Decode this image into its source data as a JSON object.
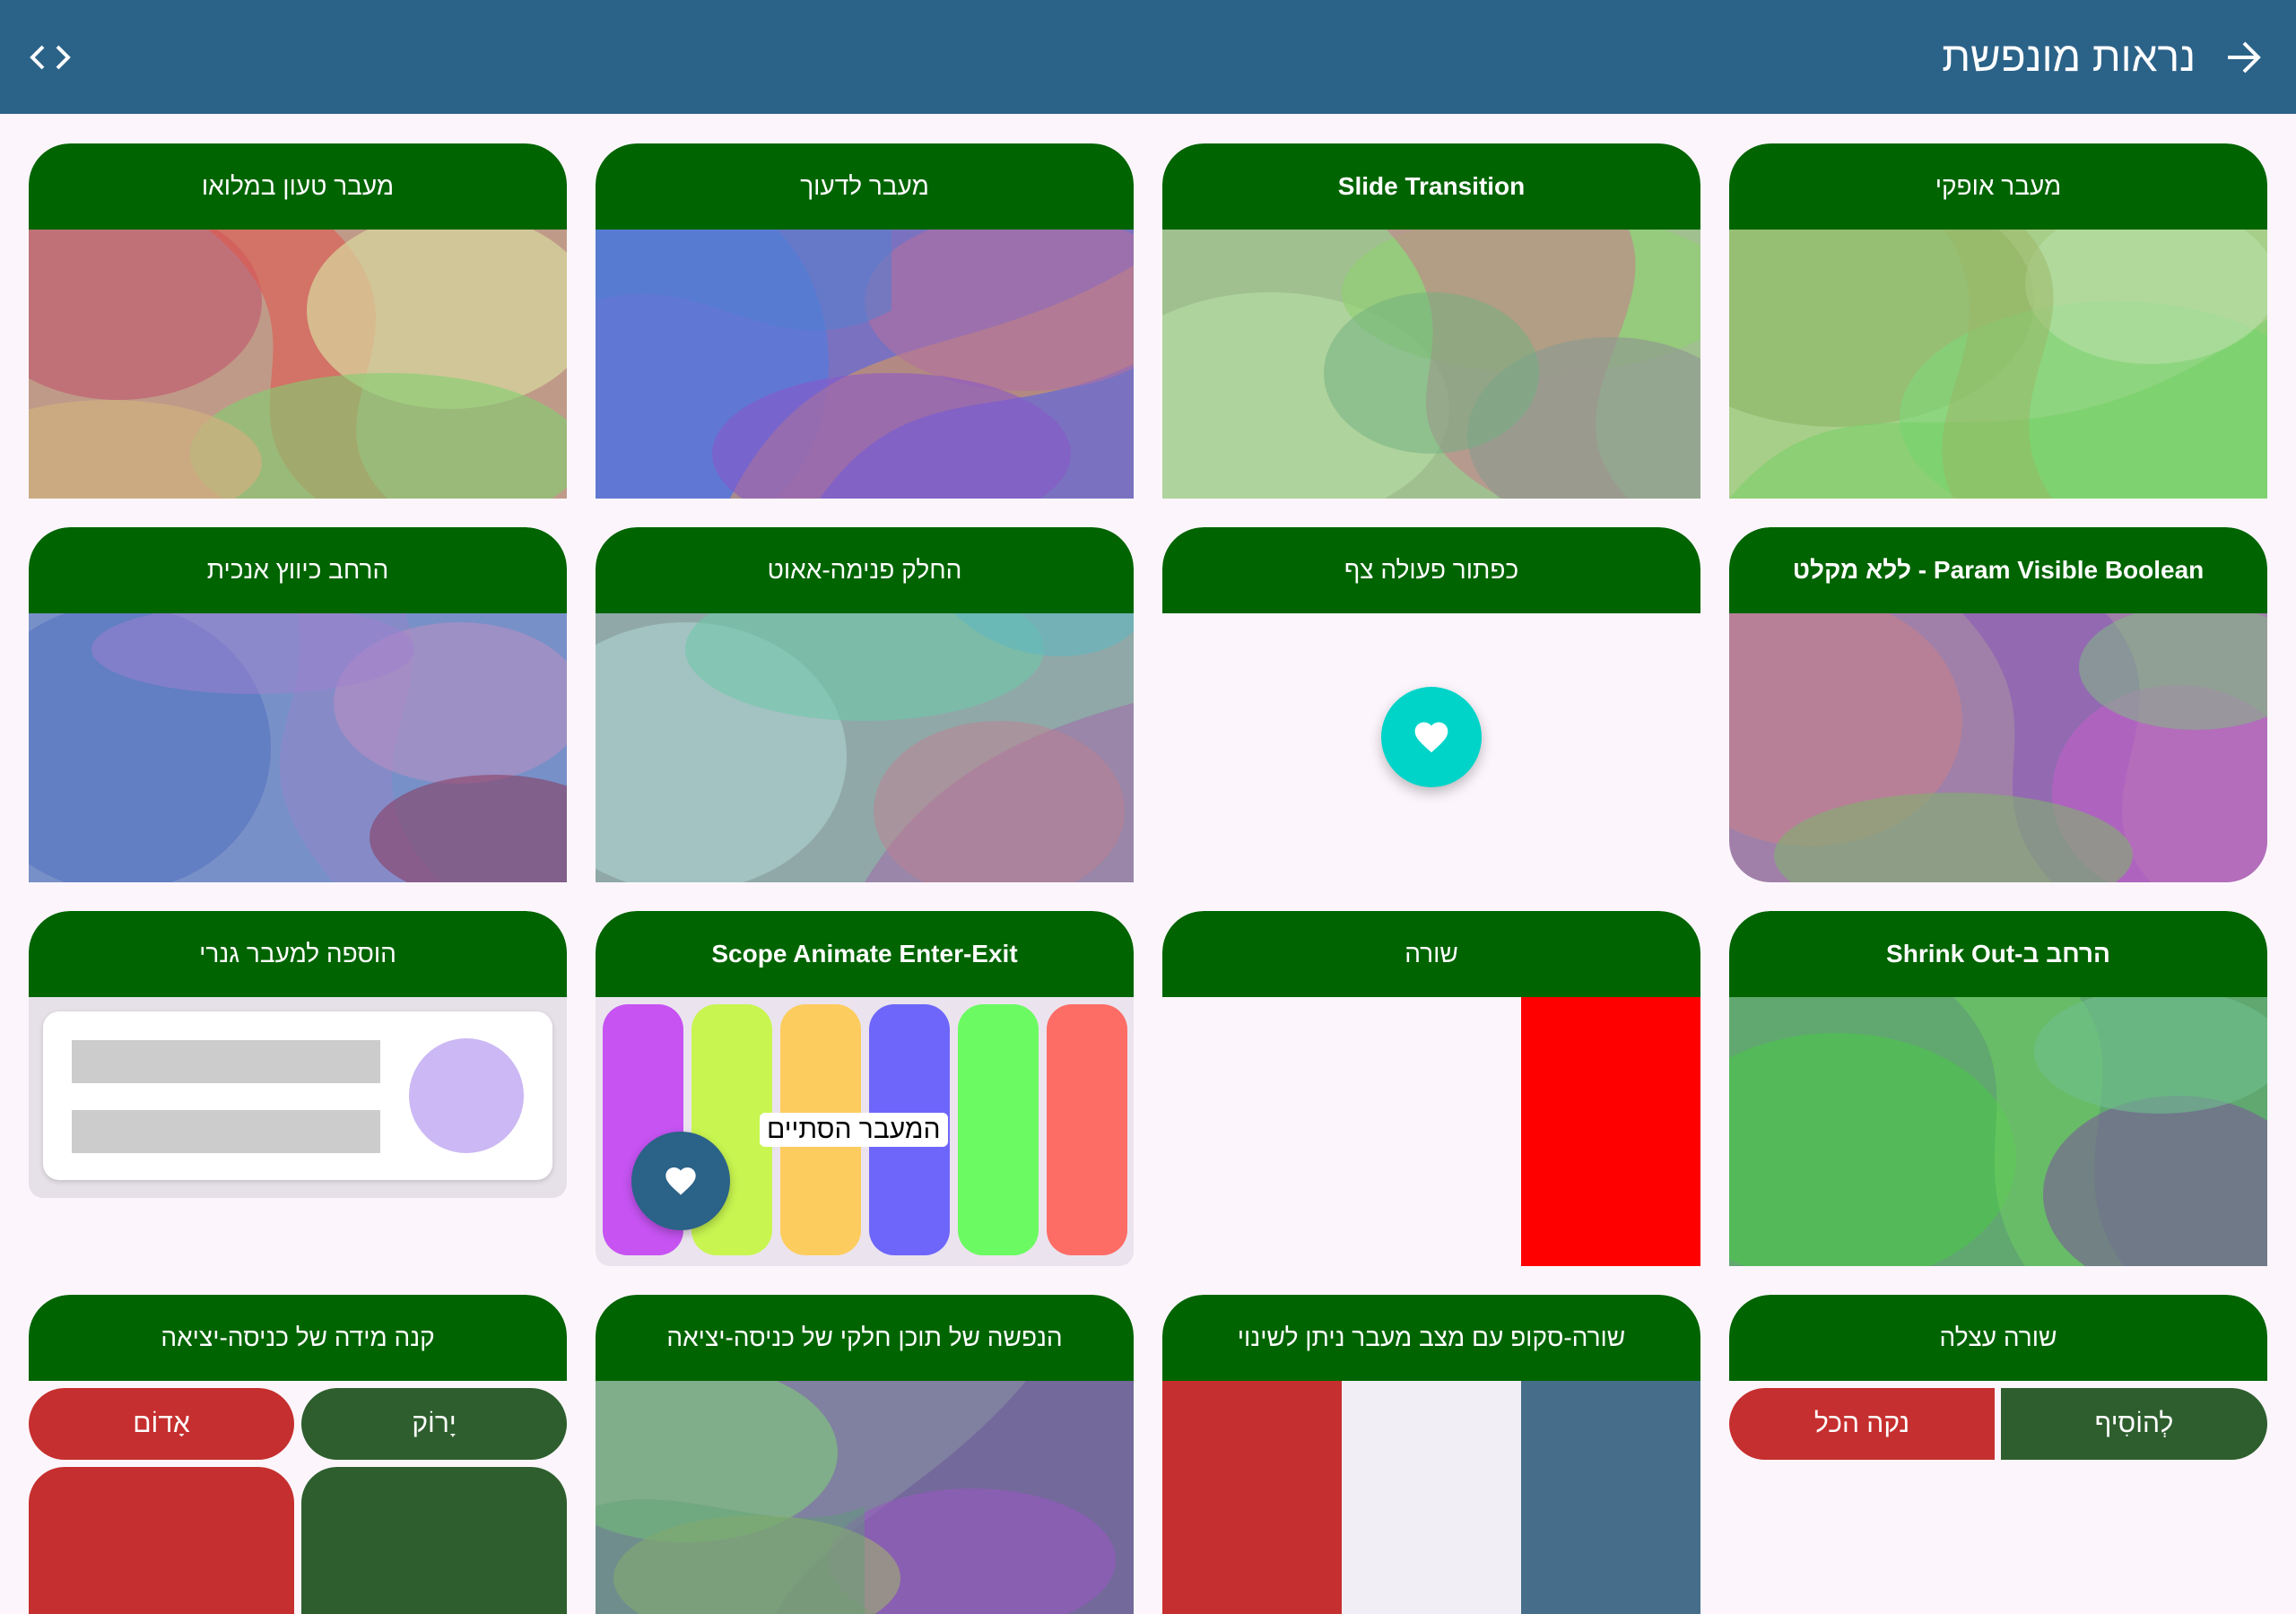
{
  "appbar": {
    "title": "נראות מונפשת",
    "back_icon": "arrow-forward-icon",
    "code_icon": "code-icon",
    "color": "#2b6288"
  },
  "colors": {
    "header_green": "#006400",
    "background": "#fcf6fc",
    "fab_teal": "#00d4c8",
    "fab_blue": "#2b6288",
    "red": "#c62f2f",
    "dark_green": "#2e5e2e"
  },
  "cards": {
    "horizontal": {
      "title": "מעבר אופקי"
    },
    "slide": {
      "title": "Slide Transition"
    },
    "fade": {
      "title": "מעבר לדעוך"
    },
    "fully_loaded": {
      "title": "מעבר טעון במלואו"
    },
    "param_visible": {
      "title": "Param Visible Boolean - ללא מקלט"
    },
    "fab": {
      "title": "כפתור פעולה צף",
      "icon": "heart-icon"
    },
    "slide_in_out": {
      "title": "החלק פנימה-אאוט"
    },
    "expand_vertical": {
      "title": "הרחב כיווץ אנכית"
    },
    "shrink_out": {
      "title": "הרחב ב-Shrink Out"
    },
    "row": {
      "title": "שורה"
    },
    "scope_enter_exit": {
      "title": "Scope Animate Enter-Exit",
      "label": "המעבר הסתיים",
      "icon": "heart-icon"
    },
    "generic_add": {
      "title": "הוספה למעבר גנרי"
    },
    "lazy_row": {
      "title": "שורה עצלה",
      "add_label": "לְהוֹסִיף",
      "clear_label": "נקה הכל"
    },
    "scope_row": {
      "title": "שורה-סקופ עם מצב מעבר ניתן לשינוי"
    },
    "partial_content": {
      "title": "הנפשה של תוכן חלקי של כניסה-יציאה"
    },
    "scale_enter_exit": {
      "title": "קנה מידה של כניסה-יציאה",
      "green_label": "יָרוֹק",
      "red_label": "אָדוֹם"
    }
  }
}
